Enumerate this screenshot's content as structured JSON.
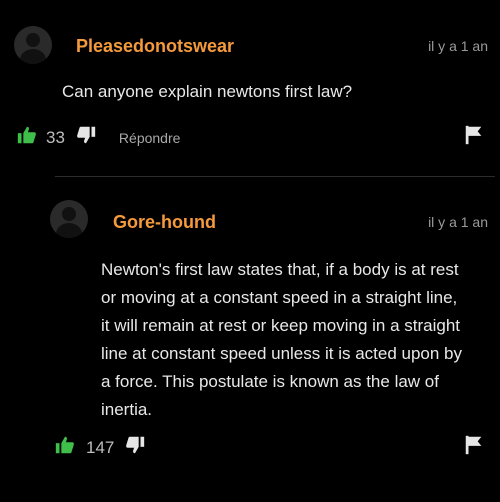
{
  "comment1": {
    "username": "Pleasedonotswear",
    "time": "il y a 1 an",
    "text": "Can anyone explain newtons first law?",
    "likes": "33",
    "reply_label": "Répondre"
  },
  "comment2": {
    "username": "Gore-hound",
    "time": "il y a 1 an",
    "text_lines": [
      "Newton's first law states that, if a body is at rest",
      "or moving at a constant speed in a straight line,",
      "it will remain at rest or keep moving in a straight",
      "line at constant speed unless it is acted upon by",
      "a force. This postulate is known as the law of",
      "inertia."
    ],
    "likes": "147"
  },
  "colors": {
    "username": "#f59a3c",
    "like_icon": "#3fbf4a",
    "background": "#000000"
  },
  "icons": {
    "like": "thumbs-up-icon",
    "dislike": "thumbs-down-icon",
    "flag": "flag-icon",
    "avatar": "avatar-icon"
  }
}
